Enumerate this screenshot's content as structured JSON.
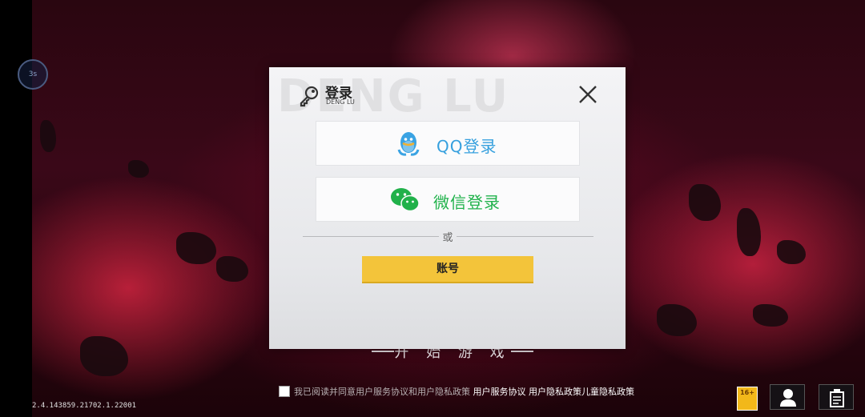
{
  "background": {
    "start_text": "开 始 游 戏",
    "side_badge": "3s"
  },
  "dialog": {
    "watermark": "DENG LU",
    "title": "登录",
    "subtitle": "DENG LU",
    "qq_login_label": "QQ登录",
    "wechat_login_label": "微信登录",
    "divider_text": "或",
    "account_label": "账号"
  },
  "footer": {
    "agreement_text": "我已阅读并同意用户服务协议和用户隐私政策",
    "link_service": "用户服务协议",
    "link_privacy": "用户隐私政策",
    "link_children": "儿童隐私政策",
    "version": "2.4.143859.21702.1.22001",
    "age_rating": "16+"
  },
  "colors": {
    "accent_yellow": "#f3c43a",
    "qq_blue": "#36a0de",
    "wechat_green": "#20b24b"
  },
  "icons": [
    "key-icon",
    "close-icon",
    "qq-penguin-icon",
    "wechat-icon",
    "user-icon",
    "notice-icon"
  ]
}
